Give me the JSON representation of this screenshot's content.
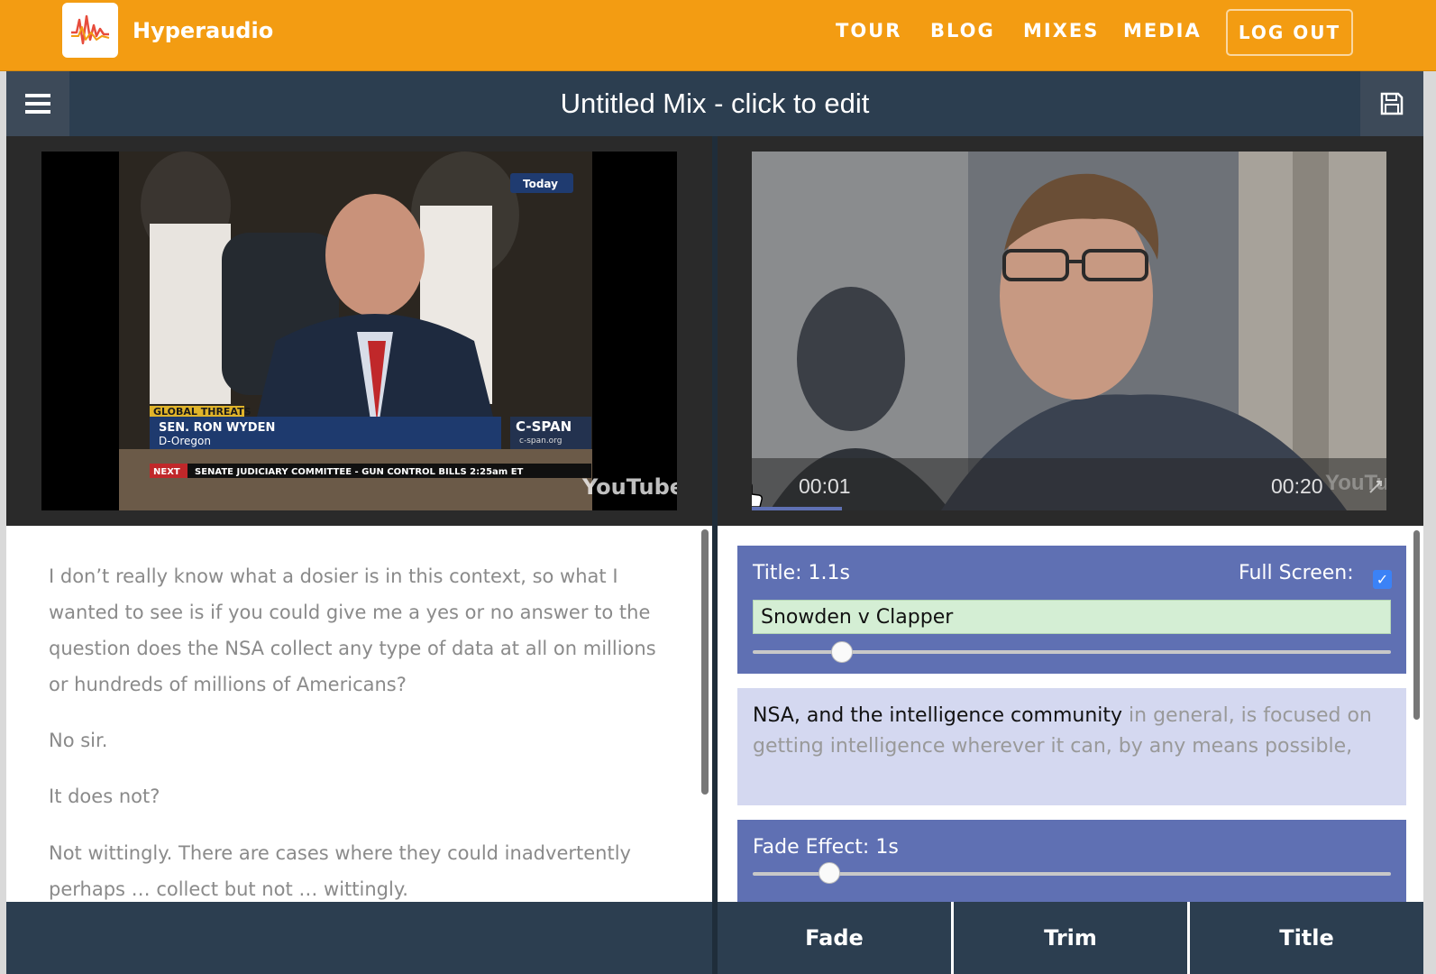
{
  "brand": {
    "name": "Hyperaudio",
    "color": "#f39c12"
  },
  "nav": {
    "items": [
      "TOUR",
      "BLOG",
      "MIXES",
      "MEDIA"
    ],
    "logout": "LOG OUT"
  },
  "mix": {
    "title": "Untitled Mix - click to edit"
  },
  "video_left": {
    "lower_third": {
      "tag": "GLOBAL THREATS",
      "name": "SEN. RON WYDEN",
      "party": "D-Oregon",
      "network": "C-SPAN",
      "network_url": "c-span.org",
      "next_label": "NEXT",
      "next_text": "SENATE JUDICIARY COMMITTEE - GUN CONTROL BILLS 2:25am ET",
      "corner_badge": "Today",
      "watermark": "YouTube"
    }
  },
  "video_right": {
    "current_time": "00:01",
    "duration": "00:20",
    "watermark": "YouTube"
  },
  "transcript": {
    "paragraphs": [
      "I don’t really know what a dosier is in this context, so what I wanted to see is if you could give me a yes or no answer to the question does the NSA collect any type of data at all on millions or hundreds of millions of Americans?",
      "No sir.",
      "It does not?",
      "Not wittingly. There are cases where they could inadvertently perhaps … collect but not … wittingly."
    ]
  },
  "edit": {
    "title_card": {
      "label": "Title: 1.1s",
      "fullscreen_label": "Full Screen:",
      "fullscreen_checked": true,
      "value": "Snowden v Clapper",
      "slider_level": 0.14
    },
    "transcript_card": {
      "active_text": "NSA, and the intelligence community",
      "rest_text": " in general, is focused on getting intelligence wherever it can, by any means possible,"
    },
    "fade_card": {
      "label": "Fade Effect: 1s",
      "slider_level": 0.12
    }
  },
  "toolbar": {
    "buttons": [
      "Fade",
      "Trim",
      "Title"
    ]
  }
}
